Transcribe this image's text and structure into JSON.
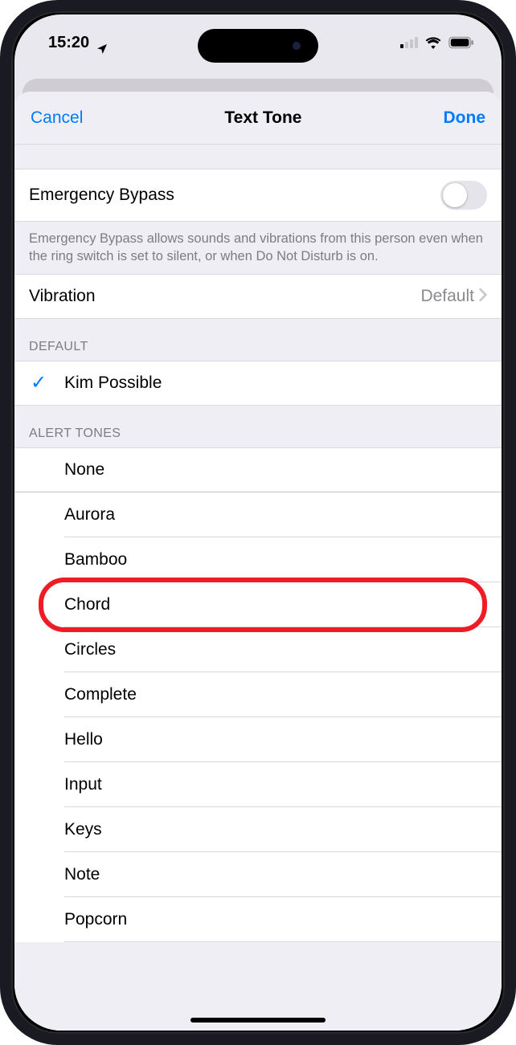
{
  "status": {
    "time": "15:20",
    "location_icon": "location-arrow",
    "signal_bars_active": 1,
    "signal_bars_total": 4
  },
  "nav": {
    "left": "Cancel",
    "title": "Text Tone",
    "right": "Done"
  },
  "emergency": {
    "label": "Emergency Bypass",
    "enabled": false,
    "footer": "Emergency Bypass allows sounds and vibrations from this person even when the ring switch is set to silent, or when Do Not Disturb is on."
  },
  "vibration": {
    "label": "Vibration",
    "value": "Default"
  },
  "sections": {
    "default_header": "DEFAULT",
    "default_item": {
      "label": "Kim Possible",
      "checked": true
    },
    "alert_header": "ALERT TONES",
    "alert_items": [
      {
        "label": "None"
      },
      {
        "label": "Aurora"
      },
      {
        "label": "Bamboo"
      },
      {
        "label": "Chord",
        "highlighted": true
      },
      {
        "label": "Circles"
      },
      {
        "label": "Complete"
      },
      {
        "label": "Hello"
      },
      {
        "label": "Input"
      },
      {
        "label": "Keys"
      },
      {
        "label": "Note"
      },
      {
        "label": "Popcorn"
      }
    ]
  }
}
